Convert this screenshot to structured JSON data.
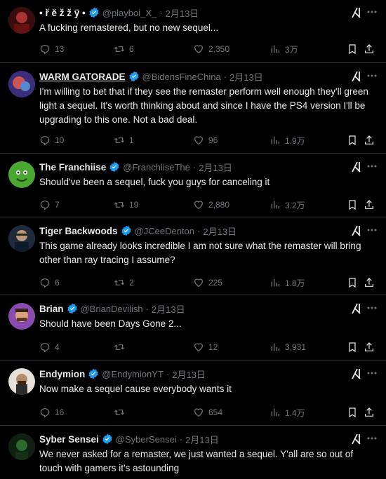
{
  "tweets": [
    {
      "name": "• ř ĕ ž ž ÿ •",
      "handle": "@playboi_X_",
      "date": "2月13日",
      "verified": true,
      "text": "A fucking remastered, but no new sequel...",
      "replies": "13",
      "retweets": "6",
      "likes": "2,350",
      "views": "3万",
      "avatar_color": "#6b1a1a"
    },
    {
      "name": "WARM GATORADE",
      "handle": "@BidensFineChina",
      "date": "2月13日",
      "verified": true,
      "text": "I'm willing to bet that if they see the remaster perform well enough they'll green light a sequel. It's worth thinking about and since I have the PS4 version I'll be upgrading to this one. Not a bad deal.",
      "replies": "10",
      "retweets": "1",
      "likes": "96",
      "views": "1.9万",
      "avatar_color": "#5b3fa0"
    },
    {
      "name": "The Franchiise",
      "handle": "@FranchiiseThe",
      "date": "2月13日",
      "verified": true,
      "text": "Should've been a sequel, fuck you guys for canceling it",
      "replies": "7",
      "retweets": "19",
      "likes": "2,880",
      "views": "3.2万",
      "avatar_color": "#3c8f2a"
    },
    {
      "name": "Tiger Backwoods",
      "handle": "@JCeeDenton",
      "date": "2月13日",
      "verified": true,
      "text": "This game already looks incredible I am not sure what the remaster will bring other than ray tracing I assume?",
      "replies": "6",
      "retweets": "2",
      "likes": "225",
      "views": "1.8万",
      "avatar_color": "#2a3a55"
    },
    {
      "name": "Brian",
      "handle": "@BrianDevilish",
      "date": "2月13日",
      "verified": true,
      "text": "Should have been Days Gone 2...",
      "replies": "4",
      "retweets": "",
      "likes": "12",
      "views": "3,931",
      "avatar_color": "#7a3b8f"
    },
    {
      "name": "Endymion",
      "handle": "@EndymionYT",
      "date": "2月13日",
      "verified": true,
      "text": "Now make a sequel cause everybody wants it",
      "replies": "16",
      "retweets": "",
      "likes": "654",
      "views": "1.4万",
      "avatar_color": "#5a4a3a"
    },
    {
      "name": "Syber Sensei",
      "handle": "@SyberSensei",
      "date": "2月13日",
      "verified": true,
      "text": "We never asked for a remaster, we just wanted a sequel. Y'all are so out of touch with gamers it's astounding",
      "replies": "",
      "retweets": "",
      "likes": "",
      "views": "",
      "avatar_color": "#1f3a1f"
    }
  ],
  "colors": {
    "verified": "#1d9bf0",
    "muted": "#71767b",
    "text": "#e7e9ea",
    "divider": "#2f3336"
  },
  "icons": [
    "reply-icon",
    "retweet-icon",
    "like-icon",
    "views-icon",
    "bookmark-icon",
    "share-icon",
    "grok-icon",
    "more-icon",
    "verified-icon"
  ]
}
